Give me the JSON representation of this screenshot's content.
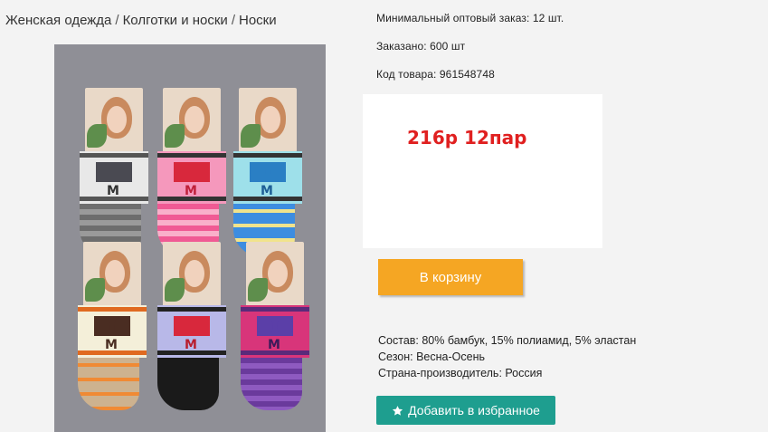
{
  "breadcrumb": {
    "items": [
      "Женская одежда",
      "Колготки и носки",
      "Носки"
    ],
    "separator": "/"
  },
  "product": {
    "min_order": "Минимальный оптовый заказ: 12 шт.",
    "ordered": "Заказано: 600 шт",
    "sku": "Код товара: 961548748",
    "price_note": "216р 12пар",
    "price_color": "#e02020",
    "image_alt": "Носки с бантиком"
  },
  "actions": {
    "cart_label": "В корзину",
    "cart_color": "#f5a623",
    "favorite_label": "Добавить в избранное",
    "favorite_icon": "star-icon",
    "favorite_color": "#1e9e8f"
  },
  "specs": {
    "composition": "Состав: 80% бамбук, 15% полиамид, 5% эластан",
    "season": "Сезон: Весна-Осень",
    "country": "Страна-производитель: Россия"
  }
}
